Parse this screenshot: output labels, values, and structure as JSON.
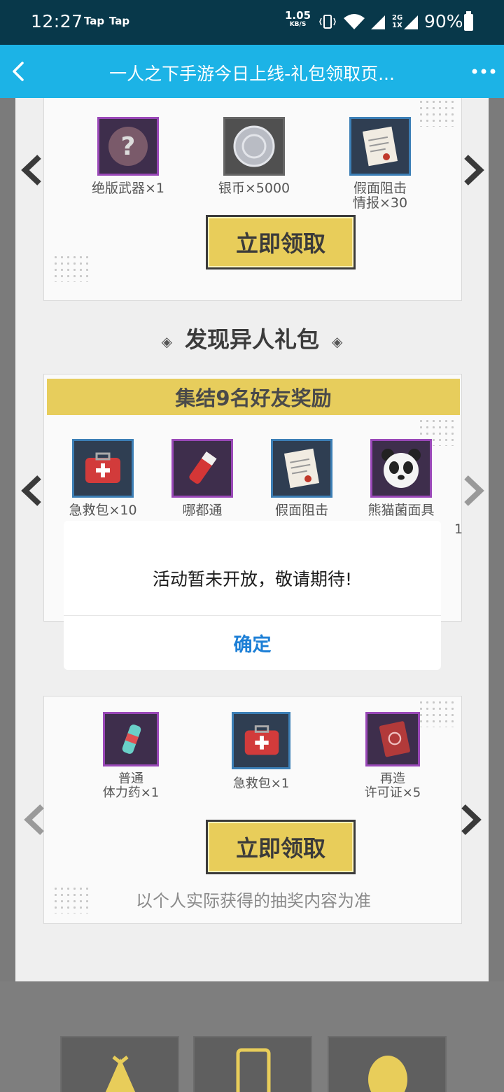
{
  "status_bar": {
    "time": "12:27",
    "notif_1": "Tap",
    "notif_2": "Tap",
    "net_speed": "1.05",
    "net_unit": "KB/S",
    "sig2_label": "2G 1X",
    "battery": "90%"
  },
  "title_bar": {
    "title": "一人之下手游今日上线-礼包领取页...",
    "back_icon": "chevron-left-icon",
    "more_icon": "more-dots-icon"
  },
  "gift_pack_1": {
    "items": [
      {
        "label": "绝版武器×1",
        "icon": "mystery-weapon-icon",
        "frame": "purple"
      },
      {
        "label": "银币×5000",
        "icon": "silver-coin-icon",
        "frame": "gray"
      },
      {
        "label": "假面阻击\n情报×30",
        "icon": "intel-document-icon",
        "frame": "blue"
      }
    ],
    "claim_label": "立即领取"
  },
  "section_discover": {
    "title": "发现异人礼包"
  },
  "gift_pack_2": {
    "banner": "集结9名好友奖励",
    "items": [
      {
        "label": "急救包×10",
        "icon": "first-aid-kit-icon",
        "frame": "blue"
      },
      {
        "label": "哪都通",
        "icon": "potion-vial-icon",
        "frame": "purple"
      },
      {
        "label": "假面阻击",
        "icon": "intel-document-icon",
        "frame": "blue"
      },
      {
        "label": "熊猫菌面具",
        "icon": "panda-mask-icon",
        "frame": "purple"
      }
    ],
    "partial_text": "1"
  },
  "gift_pack_3": {
    "items": [
      {
        "label": "普通\n体力药×1",
        "icon": "stamina-potion-icon",
        "frame": "purple"
      },
      {
        "label": "急救包×1",
        "icon": "first-aid-kit-icon",
        "frame": "blue"
      },
      {
        "label": "再造\n许可证×5",
        "icon": "permit-book-icon",
        "frame": "purple"
      }
    ],
    "claim_label": "立即领取",
    "note": "以个人实际获得的抽奖内容为准"
  },
  "dialog": {
    "message": "活动暂未开放，敬请期待!",
    "ok_label": "确定"
  },
  "colors": {
    "status_bar": "#08384a",
    "title_bar": "#1cb3e6",
    "accent_gold": "#e8cd5a",
    "ok_blue": "#1d7fd6"
  }
}
